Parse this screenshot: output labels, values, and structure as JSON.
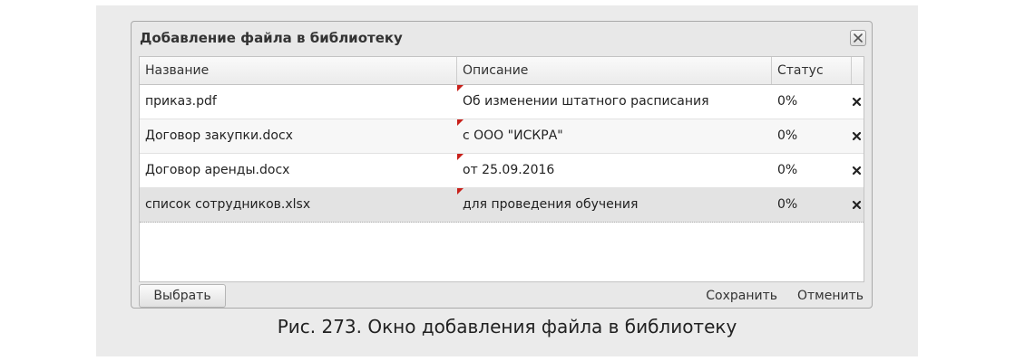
{
  "window": {
    "title": "Добавление файла в библиотеку"
  },
  "table": {
    "headers": {
      "name": "Название",
      "description": "Описание",
      "status": "Статус"
    },
    "rows": [
      {
        "name": "приказ.pdf",
        "description": "Об изменении штатного расписания",
        "status": "0%",
        "selected": false
      },
      {
        "name": "Договор закупки.docx",
        "description": "с ООО \"ИСКРА\"",
        "status": "0%",
        "selected": false
      },
      {
        "name": "Договор аренды.docx",
        "description": "от 25.09.2016",
        "status": "0%",
        "selected": false
      },
      {
        "name": "список сотрудников.xlsx",
        "description": "для проведения обучения",
        "status": "0%",
        "selected": true
      }
    ],
    "delete_icon": "close-x-icon",
    "modified_marker_color": "#c8201a"
  },
  "footer": {
    "choose_label": "Выбрать",
    "save_label": "Сохранить",
    "cancel_label": "Отменить"
  },
  "caption": "Рис. 273. Окно добавления файла в библиотеку",
  "colors": {
    "panel_background": "#ebebeb",
    "window_background": "#e8e8e8",
    "selected_row": "#e3e3e3"
  }
}
